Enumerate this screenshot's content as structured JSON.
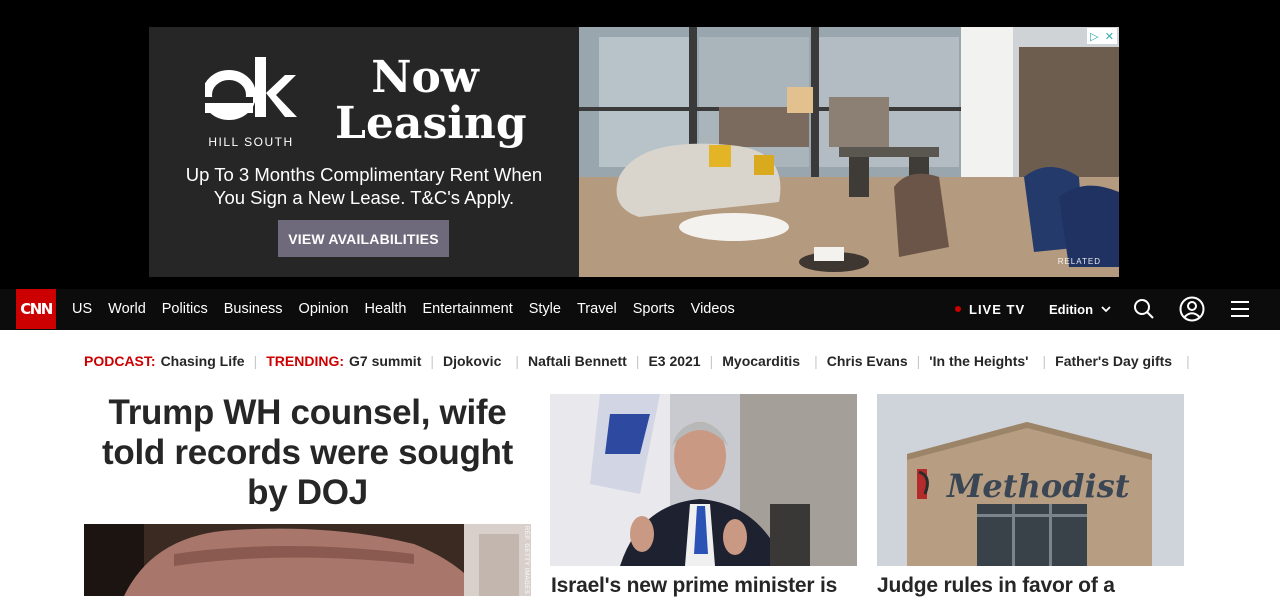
{
  "ad": {
    "brand_line": "HILL SOUTH",
    "headline_1": "Now",
    "headline_2": "Leasing",
    "offer": "Up To 3 Months Complimentary Rent When You Sign a New Lease. T&C's Apply.",
    "cta": "VIEW AVAILABILITIES",
    "related_mark": "RELATED",
    "choices_icon": "adchoices-icon",
    "close_icon": "close-icon"
  },
  "nav": {
    "logo": "CNN",
    "links": [
      "US",
      "World",
      "Politics",
      "Business",
      "Opinion",
      "Health",
      "Entertainment",
      "Style",
      "Travel",
      "Sports",
      "Videos"
    ],
    "live_tv": "LIVE TV",
    "edition": "Edition",
    "icons": [
      "search-icon",
      "user-icon",
      "menu-icon"
    ],
    "accent": "#cc0000"
  },
  "trending": {
    "podcast_label": "PODCAST:",
    "podcast_item": "Chasing Life",
    "trending_label": "TRENDING:",
    "items": [
      "G7 summit",
      "Djokovic",
      "Naftali Bennett",
      "E3 2021",
      "Myocarditis",
      "Chris Evans",
      "'In the Heights'",
      "Father's Day gifts"
    ]
  },
  "main": {
    "headline": "Trump WH counsel, wife told records were sought by DOJ",
    "photo_credit": "REP. GETTY IMAGES"
  },
  "cards": [
    {
      "headline": "Israel's new prime minister is"
    },
    {
      "headline": "Judge rules in favor of a"
    }
  ]
}
